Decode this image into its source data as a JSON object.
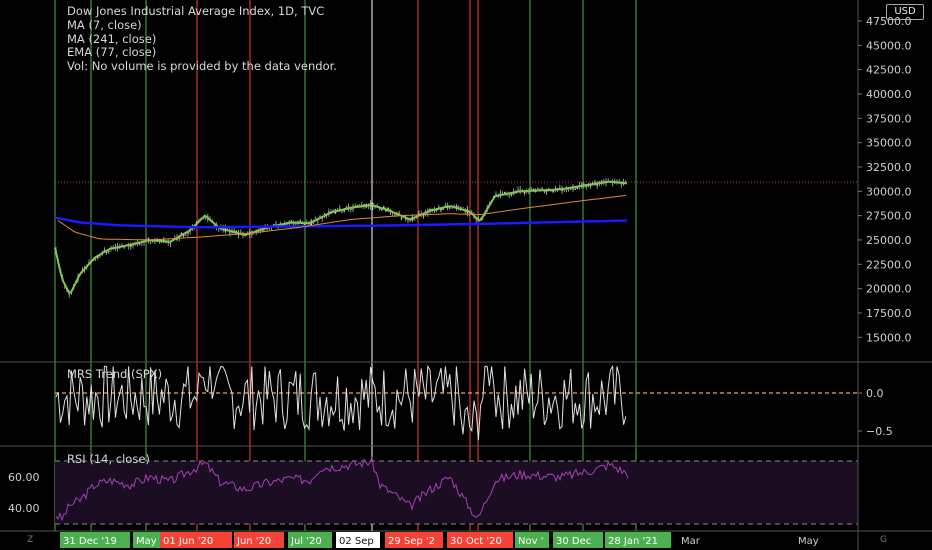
{
  "legend": {
    "title": "Dow Jones Industrial Average Index, 1D, TVC",
    "ma7": "MA (7, close)",
    "ma241": "MA (241, close)",
    "ema77": "EMA (77, close)",
    "vol": "Vol: No volume is provided by the data vendor."
  },
  "currency": "USD",
  "corners": {
    "left": "Z",
    "right": "G"
  },
  "price_axis": [
    "47500.0",
    "45000.0",
    "42500.0",
    "40000.0",
    "37500.0",
    "35000.0",
    "32500.0",
    "30000.0",
    "27500.0",
    "25000.0",
    "22500.0",
    "20000.0",
    "17500.0",
    "15000.0"
  ],
  "mrs_panel": {
    "label": "MRS Trend (SPX)",
    "ticks": [
      "0.0",
      "−0.5"
    ]
  },
  "rsi_panel": {
    "label": "RSI (14, close)",
    "ticks": [
      "60.00",
      "40.00"
    ]
  },
  "time_axis": [
    {
      "label": "31 Dec '19",
      "bg": "green"
    },
    {
      "label": "May",
      "bg": "green"
    },
    {
      "label": "01 Jun '20",
      "bg": "red"
    },
    {
      "label": "Jun '20",
      "bg": "red"
    },
    {
      "label": "Jul '20",
      "bg": "green"
    },
    {
      "label": "02 Sep",
      "bg": "white"
    },
    {
      "label": "29 Sep '2",
      "bg": "red"
    },
    {
      "label": "30 Oct '20",
      "bg": "red"
    },
    {
      "label": "Nov '",
      "bg": "green"
    },
    {
      "label": "30 Dec",
      "bg": "green"
    },
    {
      "label": "28 Jan '21",
      "bg": "green"
    },
    {
      "label": "Mar",
      "bg": "none"
    },
    {
      "label": "May",
      "bg": "none"
    }
  ],
  "colors": {
    "green_line": "#4caf50",
    "red_line": "#f44336",
    "white_line": "#ffffff",
    "ma7": "#7ec850",
    "ma241": "#1a1aff",
    "ema77": "#e08a3c",
    "candle": "#b0b0b0",
    "mrs": "#e0e0e0",
    "zero_line": "#ff9e40",
    "rsi": "#a63fb5",
    "rsi_band": "#1b0d22",
    "price_ref": "#c04040"
  }
}
